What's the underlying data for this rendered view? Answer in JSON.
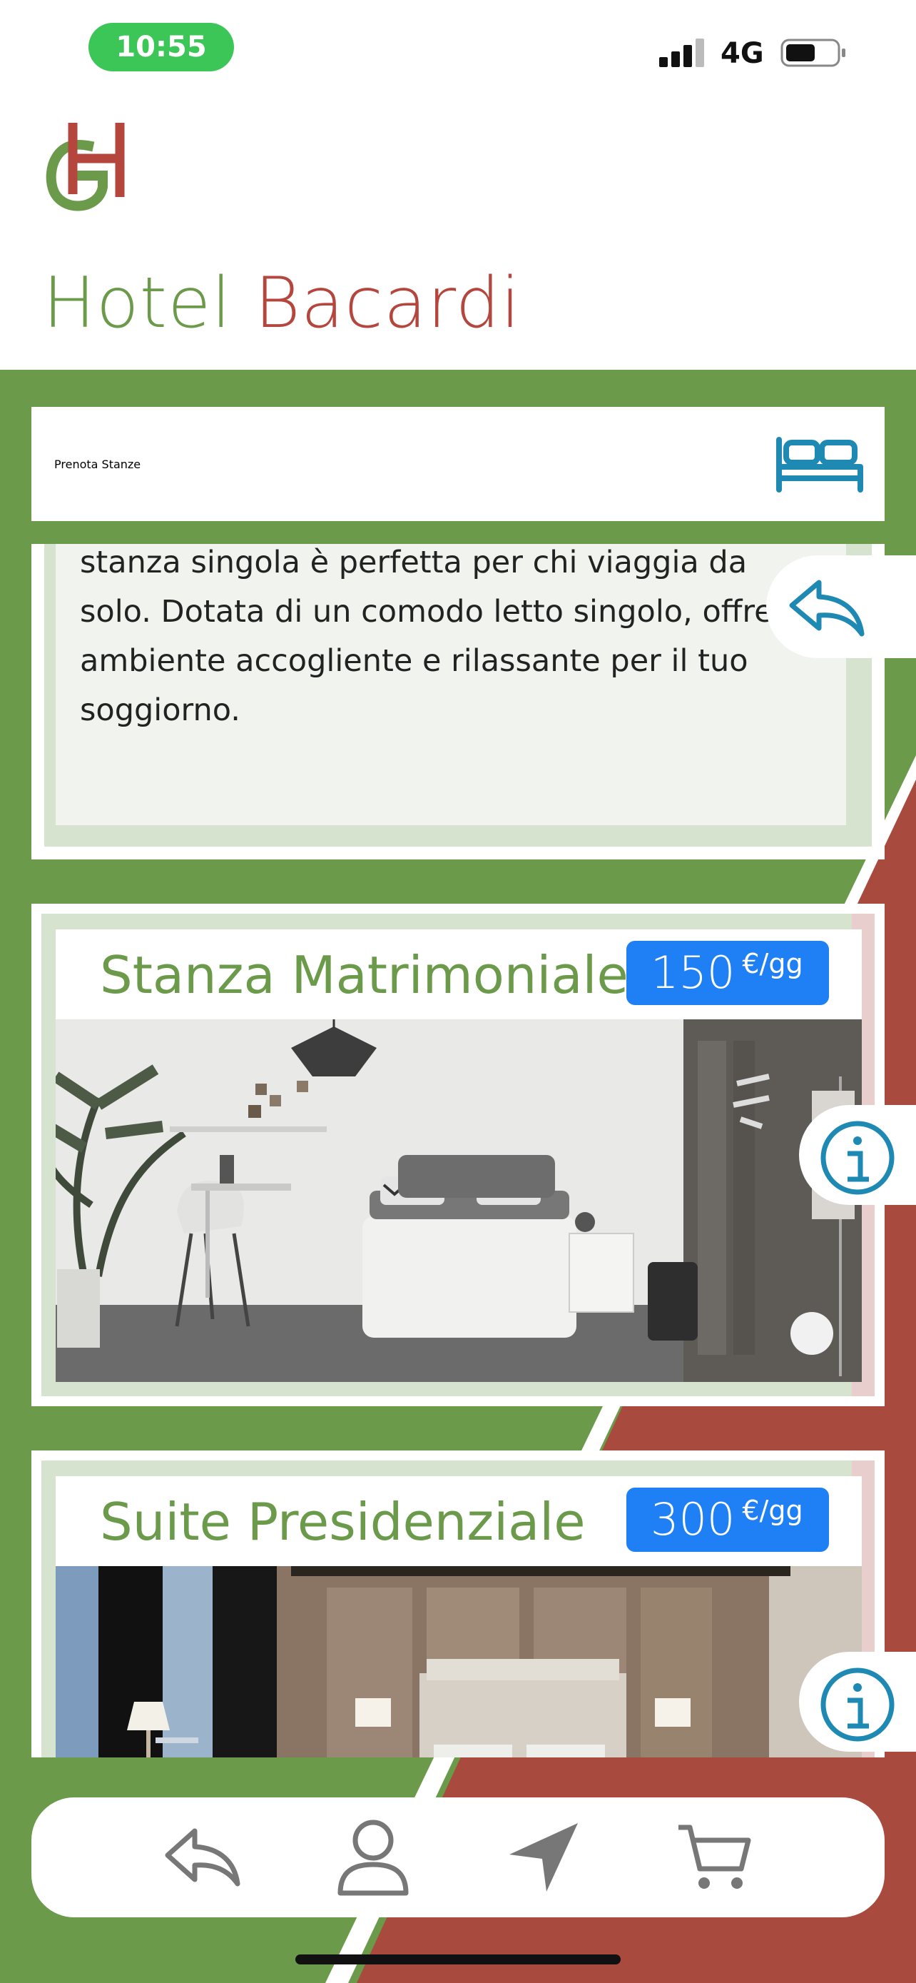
{
  "status_bar": {
    "time": "10:55",
    "network": "4G"
  },
  "header": {
    "logo_letters": "GH",
    "hotel_name_first": "Hotel",
    "hotel_name_second": "Bacardi"
  },
  "booking": {
    "label": "Prenota Stanze",
    "icon": "bed-icon"
  },
  "description": {
    "text": "stanza singola è perfetta per chi viaggia da solo. Dotata di un comodo letto singolo, offre un ambiente accogliente e rilassante per il tuo soggiorno."
  },
  "rooms": [
    {
      "title": "Stanza Matrimoniale",
      "price": "150",
      "unit": "€/gg"
    },
    {
      "title": "Suite Presidenziale",
      "price": "300",
      "unit": "€/gg"
    }
  ],
  "nav": {
    "items": [
      "back-icon",
      "profile-icon",
      "location-icon",
      "cart-icon"
    ]
  },
  "colors": {
    "green": "#6b9a4a",
    "red": "#a94a3f",
    "blue": "#1f7ff5",
    "icon_teal": "#1e8ab3"
  }
}
